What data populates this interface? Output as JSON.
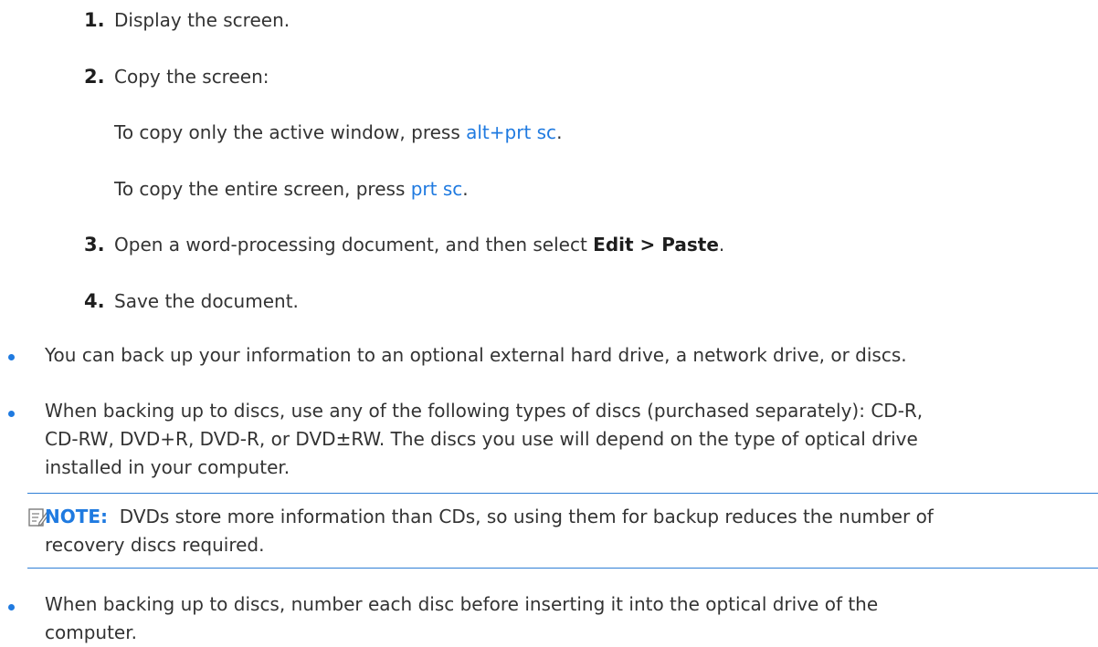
{
  "steps": [
    {
      "num": "1.",
      "text": "Display the screen."
    },
    {
      "num": "2.",
      "text": "Copy the screen:"
    },
    {
      "num": "3.",
      "text_before": "Open a word-processing document, and then select ",
      "bold": "Edit > Paste",
      "text_after": "."
    },
    {
      "num": "4.",
      "text": "Save the document."
    }
  ],
  "sub": {
    "active_before": "To copy only the active window, press ",
    "active_key": "alt+prt sc",
    "active_after": ".",
    "entire_before": "To copy the entire screen, press ",
    "entire_key": "prt sc",
    "entire_after": "."
  },
  "bullets": [
    {
      "lines": [
        "You can back up your information to an optional external hard drive, a network drive, or discs."
      ]
    },
    {
      "lines": [
        "When backing up to discs, use any of the following types of discs (purchased separately): CD-R,",
        "CD-RW, DVD+R, DVD-R, or DVD±RW. The discs you use will depend on the type of optical drive",
        "installed in your computer."
      ]
    },
    {
      "lines": [
        "When backing up to discs, number each disc before inserting it into the optical drive of the",
        "computer."
      ]
    }
  ],
  "note": {
    "label": "NOTE:",
    "line1": "DVDs store more information than CDs, so using them for backup reduces the number of",
    "line2": "recovery discs required."
  },
  "colors": {
    "accent": "#1f7ae0",
    "text": "#333333",
    "rule": "#2f7fd6"
  },
  "icons": {
    "note": "note-pencil-icon"
  }
}
